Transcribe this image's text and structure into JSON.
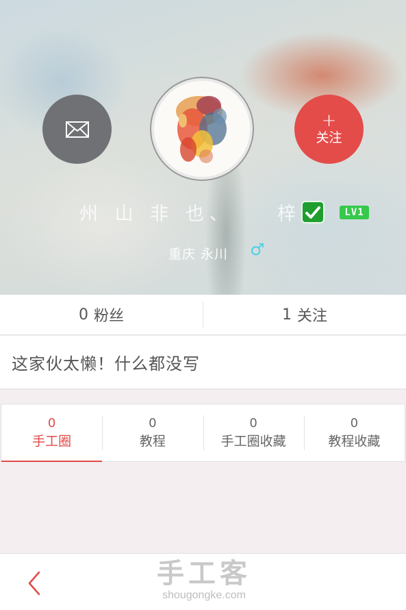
{
  "header": {
    "name_part_a": "州 山 非 也、",
    "name_part_b": "梓",
    "level": "LV1",
    "location": "重庆 永川",
    "gender_symbol": "♂",
    "follow_plus": "+",
    "follow_label": "关注"
  },
  "stats": {
    "fans_count": "0",
    "fans_label": "粉丝",
    "following_count": "1",
    "following_label": "关注"
  },
  "bio": "这家伙太懒！什么都没写",
  "tabs": [
    {
      "count": "0",
      "label": "手工圈"
    },
    {
      "count": "0",
      "label": "教程"
    },
    {
      "count": "0",
      "label": "手工圈收藏"
    },
    {
      "count": "0",
      "label": "教程收藏"
    }
  ],
  "footer": {
    "brand_cn": "手工客",
    "brand_en": "shougongke.com"
  },
  "colors": {
    "accent_red": "#e44c4a",
    "level_green": "#36c94c",
    "verified_green": "#1f9e2f",
    "gender_cyan": "#4fd0e6"
  },
  "icons": {
    "message": "envelope-icon",
    "verified": "checkmark-icon",
    "back": "chevron-left-icon"
  }
}
